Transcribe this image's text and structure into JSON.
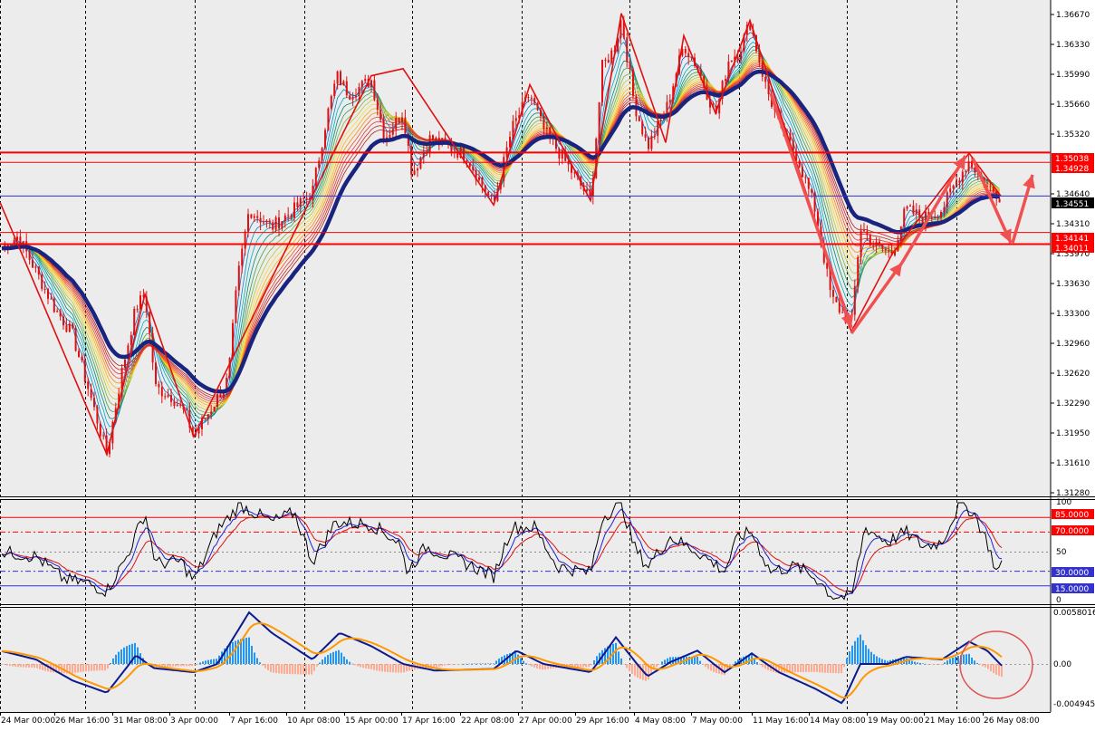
{
  "colors": {
    "background": "#ececec",
    "axis_bg": "#ffffff",
    "bull_candle": "#e01010",
    "bear_candle": "#e01010",
    "ma_main": "#1a237e",
    "level_red": "#ff0000",
    "level_blue": "#3333cc",
    "current_price_bg": "#000000",
    "macd_up": "#2196f3",
    "macd_down": "#ffab91",
    "macd_line": "#0d1a8c",
    "signal_line": "#ff9800"
  },
  "price_panel": {
    "y_ticks": [
      "1.36670",
      "1.36330",
      "1.35990",
      "1.35660",
      "1.35320",
      "1.34640",
      "1.34310",
      "1.33970",
      "1.33630",
      "1.33300",
      "1.32960",
      "1.32620",
      "1.32290",
      "1.31950",
      "1.31610",
      "1.31280"
    ],
    "level_labels": [
      "1.35038",
      "1.34928",
      "1.34141",
      "1.34011"
    ],
    "current_price": "1.34551"
  },
  "stoch_panel": {
    "y_ticks": [
      "100",
      "50",
      "0"
    ],
    "level_labels": [
      "85.0000",
      "70.0000",
      "30.0000",
      "15.0000"
    ]
  },
  "macd_panel": {
    "y_ticks": [
      "0.0058016",
      "0.00",
      "-0.0049455"
    ]
  },
  "x_axis": {
    "labels": [
      "24 Mar 00:00",
      "26 Mar 16:00",
      "31 Mar 08:00",
      "3 Apr 00:00",
      "7 Apr 16:00",
      "10 Apr 08:00",
      "15 Apr 00:00",
      "17 Apr 16:00",
      "22 Apr 08:00",
      "27 Apr 00:00",
      "29 Apr 16:00",
      "4 May 08:00",
      "7 May 00:00",
      "11 May 16:00",
      "14 May 08:00",
      "19 May 00:00",
      "21 May 16:00",
      "26 May 08:00"
    ]
  },
  "chart_data": {
    "type": "line",
    "title": "",
    "xlabel": "",
    "ylabel": "",
    "ylim": [
      1.3128,
      1.3685
    ],
    "x": [
      "24 Mar 00:00",
      "26 Mar 16:00",
      "31 Mar 08:00",
      "3 Apr 00:00",
      "7 Apr 16:00",
      "10 Apr 08:00",
      "15 Apr 00:00",
      "17 Apr 16:00",
      "22 Apr 08:00",
      "27 Apr 00:00",
      "29 Apr 16:00",
      "4 May 08:00",
      "7 May 00:00",
      "11 May 16:00",
      "14 May 08:00",
      "19 May 00:00",
      "21 May 16:00",
      "26 May 08:00"
    ],
    "series": [
      {
        "values": [
          1.339,
          1.316,
          1.335,
          1.319,
          1.333,
          1.3445,
          1.359,
          1.352,
          1.346,
          1.357,
          1.35,
          1.365,
          1.356,
          1.36,
          1.331,
          1.34,
          1.348,
          1.3455
        ]
      }
    ],
    "horizontal_levels": [
      1.35038,
      1.34928,
      1.34551,
      1.34141,
      1.34011
    ],
    "indicators": {
      "stochastic_levels": [
        85,
        70,
        50,
        30,
        15
      ],
      "macd_range": [
        -0.0049455,
        0.0058016
      ]
    }
  }
}
